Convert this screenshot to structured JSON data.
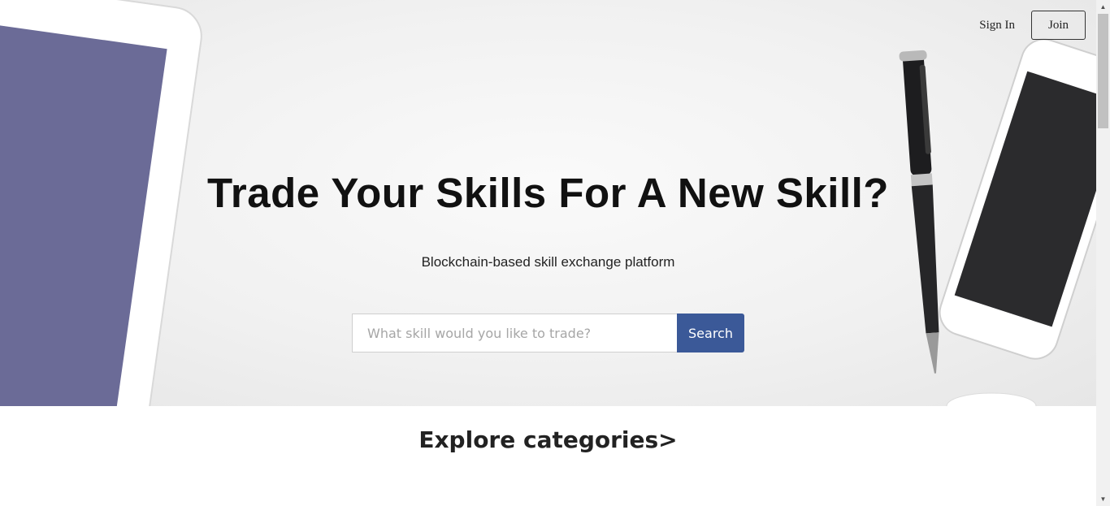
{
  "header": {
    "sign_in_label": "Sign In",
    "join_label": "Join"
  },
  "hero": {
    "title": "Trade Your Skills For A New Skill?",
    "subtitle": "Blockchain-based skill exchange platform",
    "search": {
      "placeholder": "What skill would you like to trade?",
      "value": "",
      "button_label": "Search"
    }
  },
  "explore": {
    "label": "Explore categories>"
  },
  "colors": {
    "accent": "#3b5998",
    "tablet_screen": "#6b6b97",
    "text": "#111111"
  },
  "icons": {
    "scroll_up": "scroll-up-arrow-icon",
    "scroll_down": "scroll-down-arrow-icon"
  }
}
